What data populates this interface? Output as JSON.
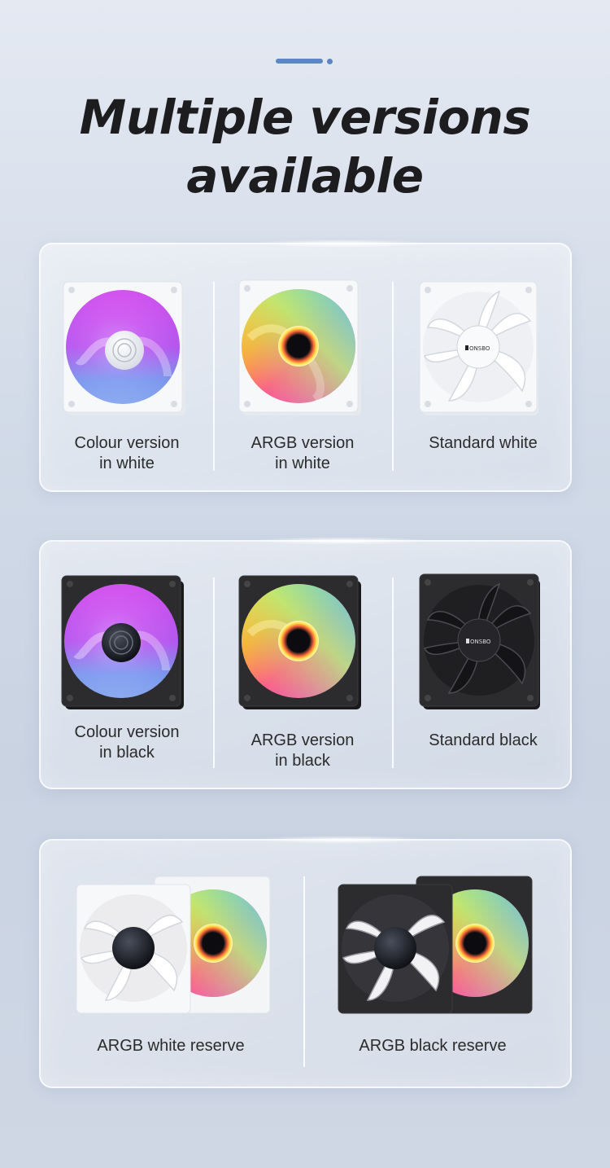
{
  "header": {
    "title_line1": "Multiple versions",
    "title_line2": "available"
  },
  "panel_white": {
    "items": [
      {
        "label_line1": "Colour version",
        "label_line2": "in white",
        "frame": "white",
        "lighting": "colour"
      },
      {
        "label_line1": "ARGB version",
        "label_line2": "in white",
        "frame": "white",
        "lighting": "argb"
      },
      {
        "label_line1": "Standard white",
        "label_line2": "",
        "frame": "white",
        "lighting": "none",
        "logo": "JONSBO"
      }
    ]
  },
  "panel_black": {
    "items": [
      {
        "label_line1": "Colour version",
        "label_line2": "in black",
        "frame": "black",
        "lighting": "colour"
      },
      {
        "label_line1": "ARGB version",
        "label_line2": "in black",
        "frame": "black",
        "lighting": "argb"
      },
      {
        "label_line1": "Standard black",
        "label_line2": "",
        "frame": "black",
        "lighting": "none",
        "logo": "JONSBO"
      }
    ]
  },
  "panel_reserve": {
    "items": [
      {
        "label": "ARGB white reserve",
        "frame": "white",
        "lighting": "argb-reverse"
      },
      {
        "label": "ARGB black reserve",
        "frame": "black",
        "lighting": "argb-reverse"
      }
    ]
  },
  "colors": {
    "accent": "#5b86c2",
    "title": "#1d1d1f",
    "frame_white": "#f4f5f7",
    "frame_black": "#2b2b2d"
  }
}
